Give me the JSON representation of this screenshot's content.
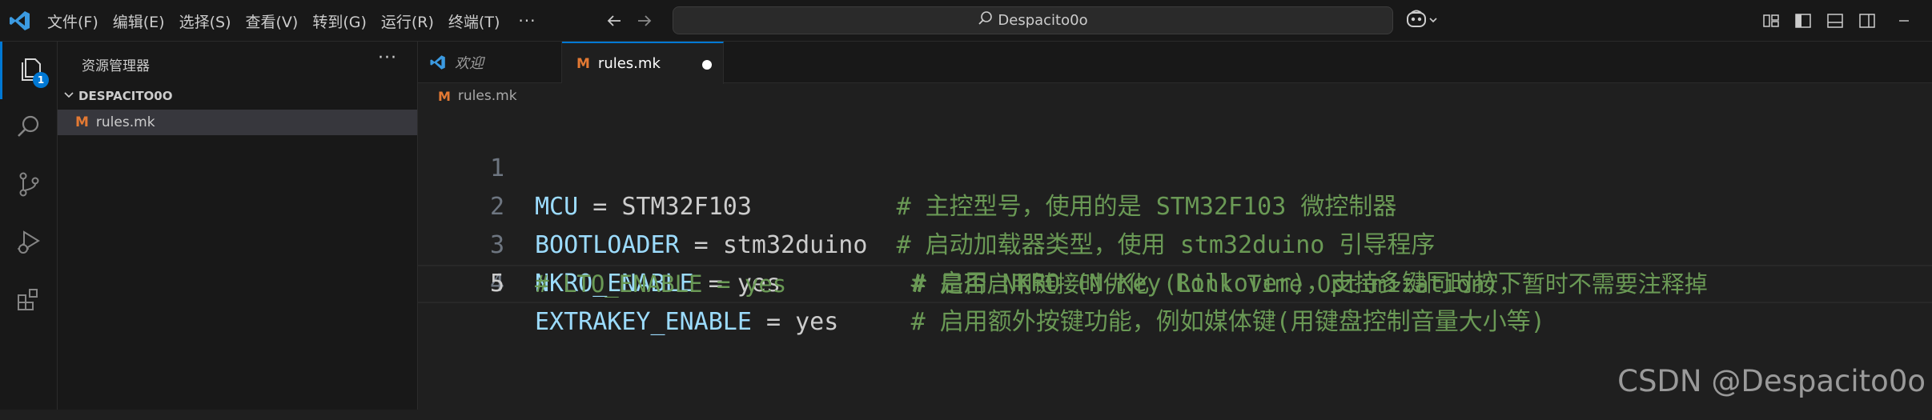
{
  "titlebar": {
    "menu": [
      "文件(F)",
      "编辑(E)",
      "选择(S)",
      "查看(V)",
      "转到(G)",
      "运行(R)",
      "终端(T)"
    ],
    "more": "···",
    "search_text": "Despacito0o"
  },
  "activity": {
    "explorer_badge": "1"
  },
  "sidebar": {
    "title": "资源管理器",
    "more": "···",
    "folder": "DESPACITO0O",
    "file_icon": "M",
    "file": "rules.mk"
  },
  "tabs": [
    {
      "label": "欢迎",
      "icon": "vscode-icon"
    },
    {
      "label": "rules.mk",
      "icon": "M"
    }
  ],
  "breadcrumb": {
    "icon": "M",
    "file": "rules.mk"
  },
  "code": [
    {
      "num": "1",
      "key": "MCU",
      "eq": " = ",
      "val": "STM32F103",
      "pad": "          ",
      "comment": "# 主控型号，使用的是 STM32F103 微控制器"
    },
    {
      "num": "2",
      "key": "BOOTLOADER",
      "eq": " = ",
      "val": "stm32duino",
      "pad": "  ",
      "comment": "# 启动加载器类型，使用 stm32duino 引导程序"
    },
    {
      "num": "3",
      "key": "NKRO_ENABLE",
      "eq": " = ",
      "val": "yes",
      "pad": "         ",
      "comment": "# 启用 NKRO (N-Key Rollover)，支持多键同时按下"
    },
    {
      "num": "4",
      "key": "EXTRAKEY_ENABLE",
      "eq": " = ",
      "val": "yes",
      "pad": "     ",
      "comment": "# 启用额外按键功能，例如媒体键(用键盘控制音量大小等)"
    },
    {
      "num": "5",
      "full": "# LTO_ENABLE = yes         # 是否启用链接时优化 (Link Time Optimization)，暂时不需要注释掉"
    }
  ],
  "watermark": "CSDN @Despacito0o"
}
